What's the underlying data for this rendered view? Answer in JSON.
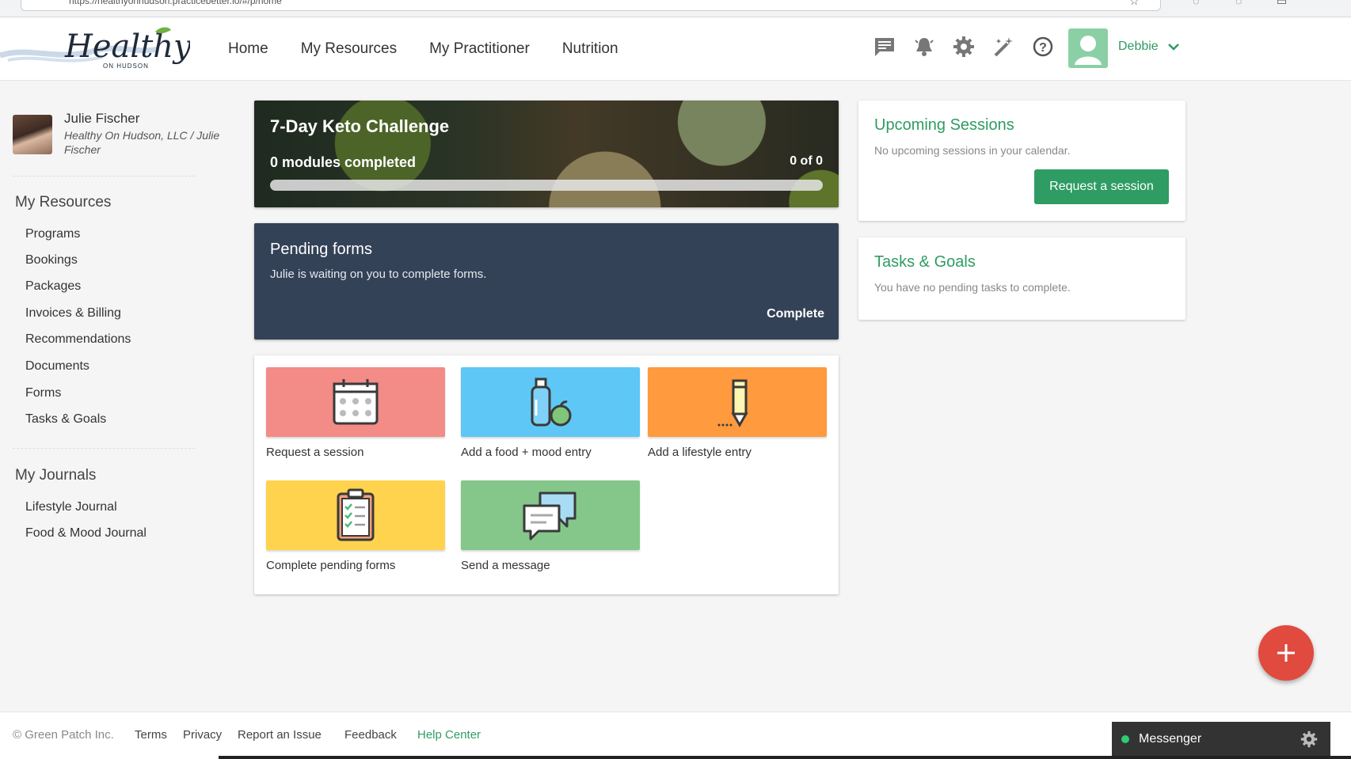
{
  "browser": {
    "url": "https://healthyonhudson.practicebetter.io/#/p/home"
  },
  "brand": {
    "logo_text": "Healthy",
    "logo_sub": "ON HUDSON",
    "accent": "#2e9c63"
  },
  "nav": {
    "links": [
      {
        "label": "Home"
      },
      {
        "label": "My Resources"
      },
      {
        "label": "My Practitioner"
      },
      {
        "label": "Nutrition"
      }
    ],
    "icons": [
      "chat-icon",
      "bell-icon",
      "gear-icon",
      "magic-wand-icon",
      "help-icon"
    ],
    "user_name": "Debbie"
  },
  "profile": {
    "name": "Julie Fischer",
    "org": "Healthy On Hudson, LLC / Julie Fischer"
  },
  "sidebar": {
    "resources_heading": "My Resources",
    "resources": [
      {
        "label": "Programs"
      },
      {
        "label": "Bookings"
      },
      {
        "label": "Packages"
      },
      {
        "label": "Invoices & Billing"
      },
      {
        "label": "Recommendations"
      },
      {
        "label": "Documents"
      },
      {
        "label": "Forms"
      },
      {
        "label": "Tasks & Goals"
      }
    ],
    "journals_heading": "My Journals",
    "journals": [
      {
        "label": "Lifestyle Journal"
      },
      {
        "label": "Food & Mood Journal"
      }
    ]
  },
  "program": {
    "title": "7-Day Keto Challenge",
    "modules_text": "0 modules completed",
    "count_text": "0 of 0",
    "progress": 0
  },
  "pending": {
    "title": "Pending forms",
    "text": "Julie is waiting on you to complete forms.",
    "action": "Complete"
  },
  "actions": [
    {
      "label": "Request a session",
      "color": "#f38b86",
      "icon": "calendar-icon"
    },
    {
      "label": "Add a food + mood entry",
      "color": "#5ec7f5",
      "icon": "food-mood-icon"
    },
    {
      "label": "Add a lifestyle entry",
      "color": "#ff9a3f",
      "icon": "pencil-icon"
    },
    {
      "label": "Complete pending forms",
      "color": "#ffd34d",
      "icon": "clipboard-icon"
    },
    {
      "label": "Send a message",
      "color": "#85c78a",
      "icon": "chat-bubbles-icon"
    }
  ],
  "sessions": {
    "title": "Upcoming Sessions",
    "text": "No upcoming sessions in your calendar.",
    "button": "Request a session"
  },
  "tasks": {
    "title": "Tasks & Goals",
    "text": "You have no pending tasks to complete."
  },
  "footer": {
    "copyright": "© Green Patch Inc.",
    "links": [
      {
        "label": "Terms"
      },
      {
        "label": "Privacy"
      },
      {
        "label": "Report an Issue"
      },
      {
        "label": "Feedback"
      },
      {
        "label": "Help Center"
      }
    ]
  },
  "messenger": {
    "label": "Messenger"
  }
}
